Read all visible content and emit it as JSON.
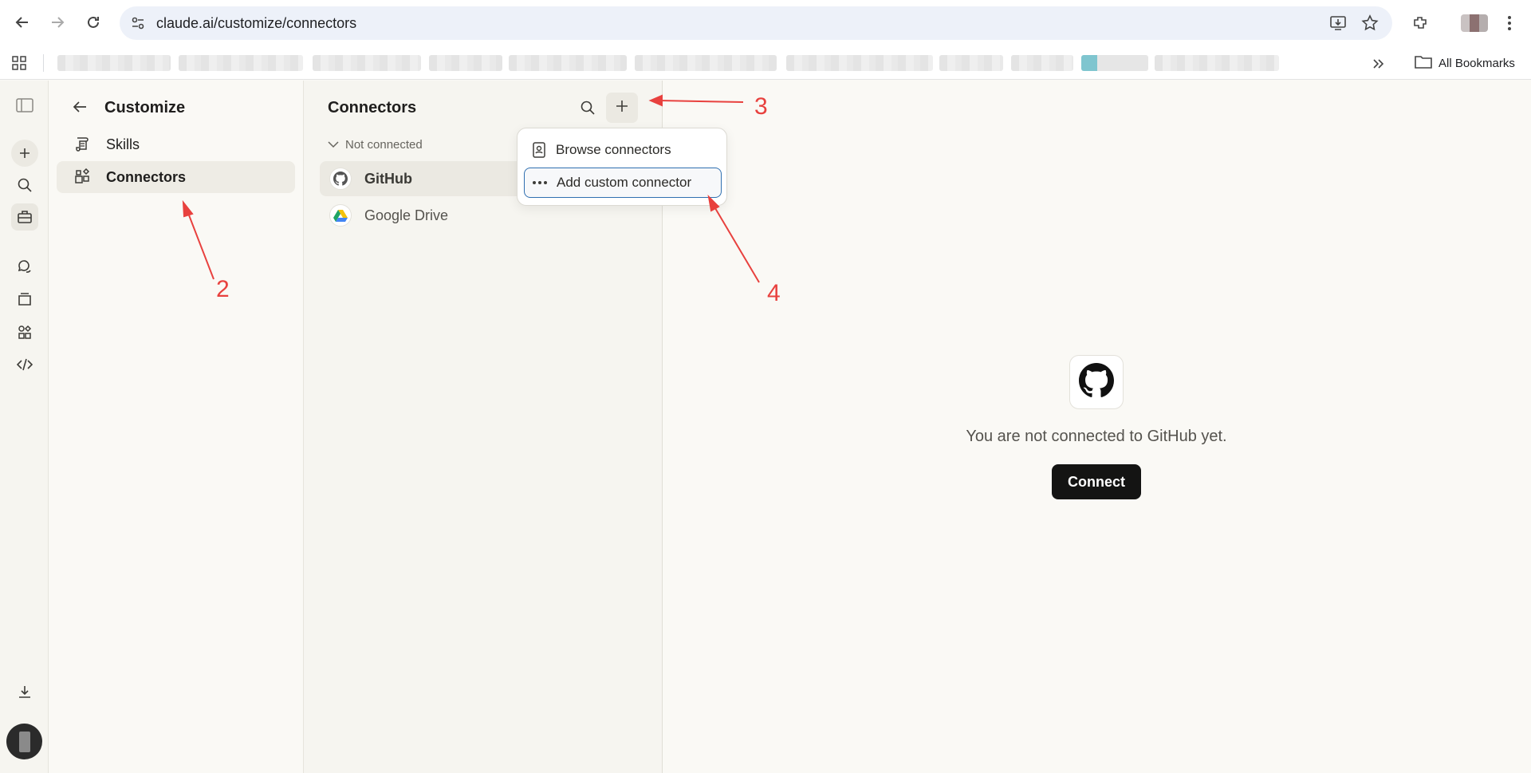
{
  "browser": {
    "url": "claude.ai/customize/connectors",
    "bookmarks_all": "All Bookmarks"
  },
  "customize": {
    "title": "Customize",
    "items": [
      {
        "label": "Skills",
        "icon": "skills-icon"
      },
      {
        "label": "Connectors",
        "icon": "connectors-icon",
        "active": true
      }
    ]
  },
  "connectors": {
    "title": "Connectors",
    "group_label": "Not connected",
    "items": [
      {
        "label": "GitHub",
        "icon": "github-icon",
        "active": true
      },
      {
        "label": "Google Drive",
        "icon": "google-drive-icon"
      }
    ]
  },
  "add_menu": {
    "items": [
      {
        "label": "Browse connectors",
        "icon": "book-icon"
      },
      {
        "label": "Add custom connector",
        "icon": "more-horizontal-icon",
        "focused": true
      }
    ]
  },
  "detail": {
    "message": "You are not connected to GitHub yet.",
    "connect_label": "Connect"
  },
  "annotations": {
    "labels": [
      "2",
      "3",
      "4"
    ],
    "color": "#e8413e"
  },
  "colors": {
    "accent_dark": "#141413",
    "focus_ring": "#2f6fb0",
    "background": "#faf9f5"
  }
}
